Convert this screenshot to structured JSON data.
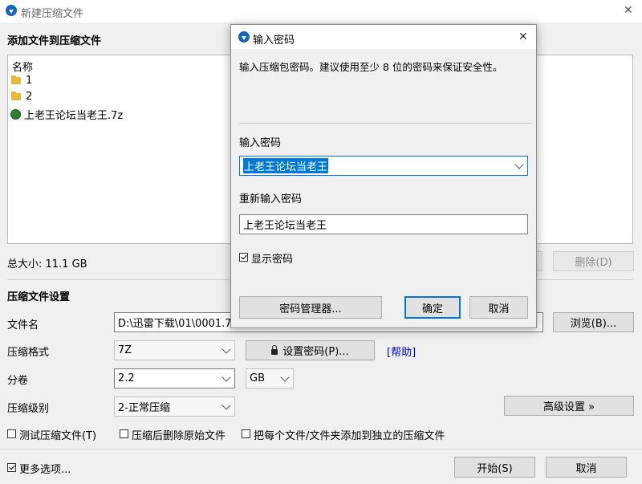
{
  "main_window": {
    "title": "新建压缩文件",
    "close_glyph": "✕",
    "add_section_title": "添加文件到压缩文件",
    "file_list": {
      "header": "名称",
      "items": [
        {
          "name": "1",
          "icon": "folder-icon"
        },
        {
          "name": "2",
          "icon": "folder-icon"
        },
        {
          "name": "上老王论坛当老王.7z",
          "icon": "archive-icon"
        }
      ]
    },
    "total_size": "总大小: 11.1 GB",
    "delete_button": "删除(D)",
    "settings_title": "压缩文件设置",
    "filename_label": "文件名",
    "filename_value": "D:\\迅雷下载\\01\\0001.7z",
    "browse_button": "浏览(B)...",
    "format_label": "压缩格式",
    "format_value": "7Z",
    "set_password_button": "设置密码(P)...",
    "help_link": "[帮助]",
    "volume_label": "分卷",
    "volume_value": "2.2",
    "volume_unit": "GB",
    "level_label": "压缩级别",
    "level_value": "2-正常压缩",
    "advanced_button": "高级设置 »",
    "test_checkbox": "测试压缩文件(T)",
    "delete_after_checkbox": "压缩后删除原始文件",
    "separate_checkbox": "把每个文件/文件夹添加到独立的压缩文件",
    "more_options_checkbox": "更多选项...",
    "start_button": "开始(S)",
    "cancel_button": "取消"
  },
  "dialog": {
    "title": "输入密码",
    "close_glyph": "✕",
    "description": "输入压缩包密码。建议使用至少 8 位的密码来保证安全性。",
    "password_label": "输入密码",
    "password_value": "上老王论坛当老王",
    "reenter_label": "重新输入密码",
    "reenter_value": "上老王论坛当老王",
    "show_password": "显示密码",
    "manager_button": "密码管理器...",
    "ok_button": "确定",
    "cancel_button": "取消"
  },
  "colors": {
    "accent": "#0078d7",
    "selection": "#0078d7",
    "link": "#0000ee",
    "app_icon": "#1565c0"
  }
}
